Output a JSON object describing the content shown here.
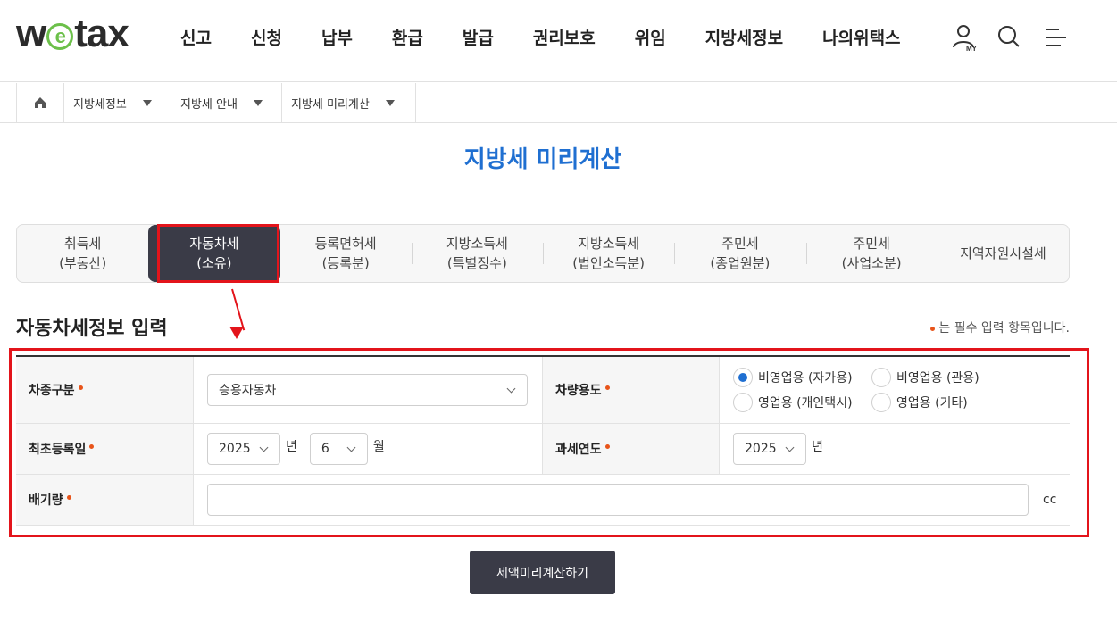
{
  "header": {
    "logo": {
      "prefix": "w",
      "e": "e",
      "suffix": "tax"
    },
    "nav": [
      "신고",
      "신청",
      "납부",
      "환급",
      "발급",
      "권리보호",
      "위임",
      "지방세정보",
      "나의위택스"
    ],
    "my_label": "MY"
  },
  "breadcrumb": [
    {
      "label": "지방세정보"
    },
    {
      "label": "지방세 안내"
    },
    {
      "label": "지방세 미리계산"
    }
  ],
  "page_title": "지방세 미리계산",
  "tabs": [
    {
      "label": "취득세\n(부동산)",
      "active": false
    },
    {
      "label": "자동차세\n(소유)",
      "active": true
    },
    {
      "label": "등록면허세\n(등록분)",
      "active": false
    },
    {
      "label": "지방소득세\n(특별징수)",
      "active": false
    },
    {
      "label": "지방소득세\n(법인소득분)",
      "active": false
    },
    {
      "label": "주민세\n(종업원분)",
      "active": false
    },
    {
      "label": "주민세\n(사업소분)",
      "active": false
    },
    {
      "label": "지역자원시설세",
      "active": false
    }
  ],
  "section": {
    "title": "자동차세정보 입력",
    "required_note": "는 필수 입력 항목입니다."
  },
  "form": {
    "vehicle_type": {
      "label": "차종구분",
      "value": "승용자동차"
    },
    "vehicle_use": {
      "label": "차량용도",
      "options": [
        {
          "label": "비영업용 (자가용)",
          "checked": true
        },
        {
          "label": "비영업용 (관용)",
          "checked": false
        },
        {
          "label": "영업용 (개인택시)",
          "checked": false
        },
        {
          "label": "영업용 (기타)",
          "checked": false
        }
      ]
    },
    "first_registration": {
      "label": "최초등록일",
      "year": "2025",
      "year_unit": "년",
      "month": "6",
      "month_unit": "월"
    },
    "tax_year": {
      "label": "과세연도",
      "value": "2025",
      "unit": "년"
    },
    "displacement": {
      "label": "배기량",
      "value": "",
      "unit": "cc"
    }
  },
  "submit_label": "세액미리계산하기",
  "colors": {
    "accent_blue": "#1f6fd1",
    "dark_tab": "#3a3b47",
    "required_dot": "#e8541a",
    "annotation_red": "#e3141b",
    "logo_green": "#6cc04a"
  }
}
